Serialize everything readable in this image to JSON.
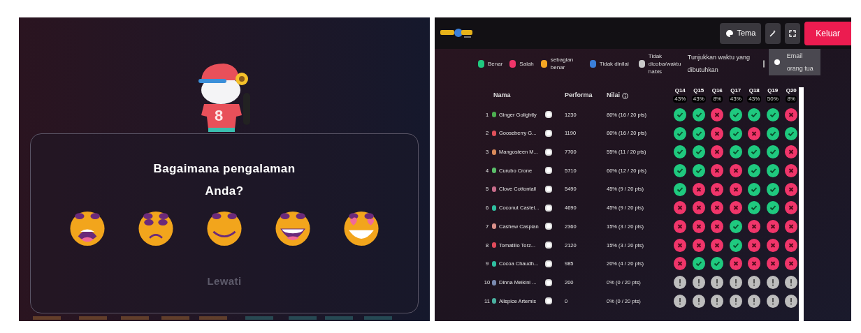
{
  "left_panel": {
    "mascot": {
      "jersey_number": "8"
    },
    "question": "Bagaimana pengalaman Anda?",
    "reactions": [
      {
        "kind": "crying"
      },
      {
        "kind": "sad"
      },
      {
        "kind": "smile"
      },
      {
        "kind": "laugh"
      },
      {
        "kind": "love"
      }
    ],
    "skip_link": "Lewati"
  },
  "right_panel": {
    "header": {
      "buttons": [
        {
          "kind": "theme",
          "label": "Tema"
        },
        {
          "kind": "tool"
        },
        {
          "kind": "fullscreen"
        },
        {
          "kind": "exit",
          "label": "Keluar"
        }
      ]
    },
    "legend": [
      {
        "label": "Benar",
        "color": "#1fc97f"
      },
      {
        "label": "Salah",
        "color": "#f0356a"
      },
      {
        "label": "sebagian benar",
        "color": "#f5a623"
      },
      {
        "label": "Tidak dinilai",
        "color": "#3b7fd9"
      },
      {
        "label": "Tidak dicoba/waktu habis",
        "color": "#c9c9c9"
      }
    ],
    "show_time": {
      "label": "Tunjukkan waktu yang dibutuhkan",
      "checked": false
    },
    "parent_email": {
      "label": "Email orang tua",
      "checked": false
    },
    "table": {
      "columns": [
        "Nama",
        "Performa",
        "Nilai"
      ],
      "questions": [
        {
          "label": "Q14",
          "percent": "43%"
        },
        {
          "label": "Q15",
          "percent": "43%"
        },
        {
          "label": "Q16",
          "percent": "8%"
        },
        {
          "label": "Q17",
          "percent": "43%"
        },
        {
          "label": "Q18",
          "percent": "43%"
        },
        {
          "label": "Q19",
          "percent": "50%"
        },
        {
          "label": "Q20",
          "percent": "8%"
        }
      ],
      "rows": [
        {
          "rank": "1",
          "name": "Ginger Golightly",
          "color": "#4caf50",
          "score": "1230",
          "grade": "80% (16 / 20 pts)",
          "answers": [
            {
              "kind": "correct"
            },
            {
              "kind": "correct"
            },
            {
              "kind": "wrong"
            },
            {
              "kind": "correct"
            },
            {
              "kind": "correct"
            },
            {
              "kind": "correct"
            },
            {
              "kind": "wrong"
            }
          ]
        },
        {
          "rank": "2",
          "name": "Gooseberry G...",
          "color": "#e0505a",
          "score": "1190",
          "grade": "80% (16 / 20 pts)",
          "answers": [
            {
              "kind": "correct"
            },
            {
              "kind": "correct"
            },
            {
              "kind": "wrong"
            },
            {
              "kind": "correct"
            },
            {
              "kind": "wrong"
            },
            {
              "kind": "correct"
            },
            {
              "kind": "correct"
            }
          ]
        },
        {
          "rank": "3",
          "name": "Mangosteen M...",
          "color": "#d98a5a",
          "score": "7700",
          "grade": "55% (11 / 20 pts)",
          "answers": [
            {
              "kind": "correct"
            },
            {
              "kind": "correct"
            },
            {
              "kind": "wrong"
            },
            {
              "kind": "correct"
            },
            {
              "kind": "correct"
            },
            {
              "kind": "correct"
            },
            {
              "kind": "wrong"
            }
          ]
        },
        {
          "rank": "4",
          "name": "Curubo Crone",
          "color": "#5bbf6a",
          "score": "5710",
          "grade": "60% (12 / 20 pts)",
          "answers": [
            {
              "kind": "correct"
            },
            {
              "kind": "correct"
            },
            {
              "kind": "wrong"
            },
            {
              "kind": "wrong"
            },
            {
              "kind": "correct"
            },
            {
              "kind": "correct"
            },
            {
              "kind": "wrong"
            }
          ]
        },
        {
          "rank": "5",
          "name": "Clove Cottontail",
          "color": "#c76b8a",
          "score": "5490",
          "grade": "45% (9 / 20 pts)",
          "answers": [
            {
              "kind": "correct"
            },
            {
              "kind": "wrong"
            },
            {
              "kind": "wrong"
            },
            {
              "kind": "wrong"
            },
            {
              "kind": "correct"
            },
            {
              "kind": "correct"
            },
            {
              "kind": "wrong"
            }
          ]
        },
        {
          "rank": "6",
          "name": "Coconut Castel...",
          "color": "#2fbfa0",
          "score": "4690",
          "grade": "45% (9 / 20 pts)",
          "answers": [
            {
              "kind": "wrong"
            },
            {
              "kind": "wrong"
            },
            {
              "kind": "wrong"
            },
            {
              "kind": "wrong"
            },
            {
              "kind": "correct"
            },
            {
              "kind": "correct"
            },
            {
              "kind": "wrong"
            }
          ]
        },
        {
          "rank": "7",
          "name": "Cashew Caspian",
          "color": "#d9908a",
          "score": "2360",
          "grade": "15% (3 / 20 pts)",
          "answers": [
            {
              "kind": "wrong"
            },
            {
              "kind": "wrong"
            },
            {
              "kind": "wrong"
            },
            {
              "kind": "correct"
            },
            {
              "kind": "wrong"
            },
            {
              "kind": "wrong"
            },
            {
              "kind": "wrong"
            }
          ]
        },
        {
          "rank": "8",
          "name": "Tomatillo Torz...",
          "color": "#e04a5a",
          "score": "2120",
          "grade": "15% (3 / 20 pts)",
          "answers": [
            {
              "kind": "wrong"
            },
            {
              "kind": "wrong"
            },
            {
              "kind": "wrong"
            },
            {
              "kind": "correct"
            },
            {
              "kind": "wrong"
            },
            {
              "kind": "wrong"
            },
            {
              "kind": "wrong"
            }
          ]
        },
        {
          "rank": "9",
          "name": "Cocoa Chaudh...",
          "color": "#2fbfa0",
          "score": "985",
          "grade": "20% (4 / 20 pts)",
          "answers": [
            {
              "kind": "wrong"
            },
            {
              "kind": "correct"
            },
            {
              "kind": "correct"
            },
            {
              "kind": "wrong"
            },
            {
              "kind": "wrong"
            },
            {
              "kind": "wrong"
            },
            {
              "kind": "wrong"
            }
          ]
        },
        {
          "rank": "10",
          "name": "Dinna Meikini ...",
          "color": "#7a8ab0",
          "score": "200",
          "grade": "0% (0 / 20 pts)",
          "answers": [
            {
              "kind": "unattempted"
            },
            {
              "kind": "unattempted"
            },
            {
              "kind": "unattempted"
            },
            {
              "kind": "unattempted"
            },
            {
              "kind": "unattempted"
            },
            {
              "kind": "unattempted"
            },
            {
              "kind": "unattempted"
            }
          ]
        },
        {
          "rank": "11",
          "name": "Allspice Artemis",
          "color": "#4ab0a0",
          "score": "0",
          "grade": "0% (0 / 20 pts)",
          "answers": [
            {
              "kind": "unattempted"
            },
            {
              "kind": "unattempted"
            },
            {
              "kind": "unattempted"
            },
            {
              "kind": "unattempted"
            },
            {
              "kind": "unattempted"
            },
            {
              "kind": "unattempted"
            },
            {
              "kind": "unattempted"
            }
          ]
        }
      ]
    }
  }
}
